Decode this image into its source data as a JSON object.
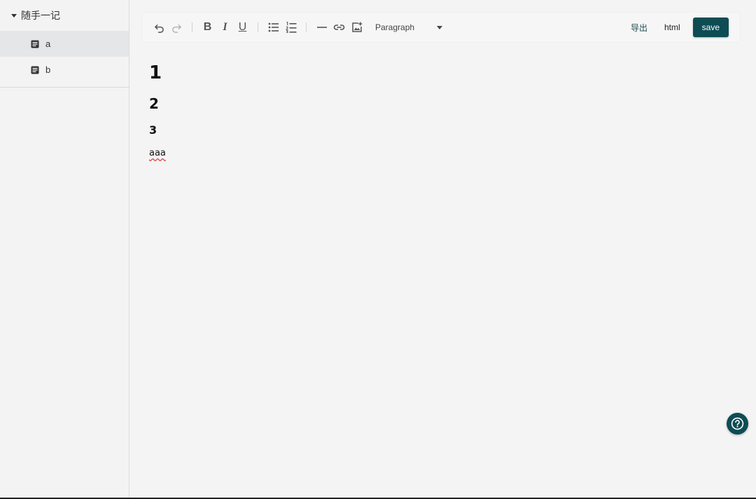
{
  "sidebar": {
    "root_label": "随手一记",
    "items": [
      {
        "label": "a",
        "active": true
      },
      {
        "label": "b",
        "active": false
      }
    ]
  },
  "toolbar": {
    "paragraph_select": "Paragraph",
    "export_label": "导出",
    "html_label": "html",
    "save_label": "save"
  },
  "content": {
    "h1": "1",
    "h2": "2",
    "h3": "3",
    "paragraph": "aaa"
  },
  "colors": {
    "accent": "#0e4c54",
    "sidebar_active": "#e4e6e7",
    "background": "#f4f4f4"
  },
  "icons": [
    "caret-down-icon",
    "document-icon",
    "undo-icon",
    "redo-icon",
    "bold-icon",
    "italic-icon",
    "underline-icon",
    "bullet-list-icon",
    "numbered-list-icon",
    "horizontal-rule-icon",
    "link-icon",
    "image-icon",
    "help-icon"
  ]
}
